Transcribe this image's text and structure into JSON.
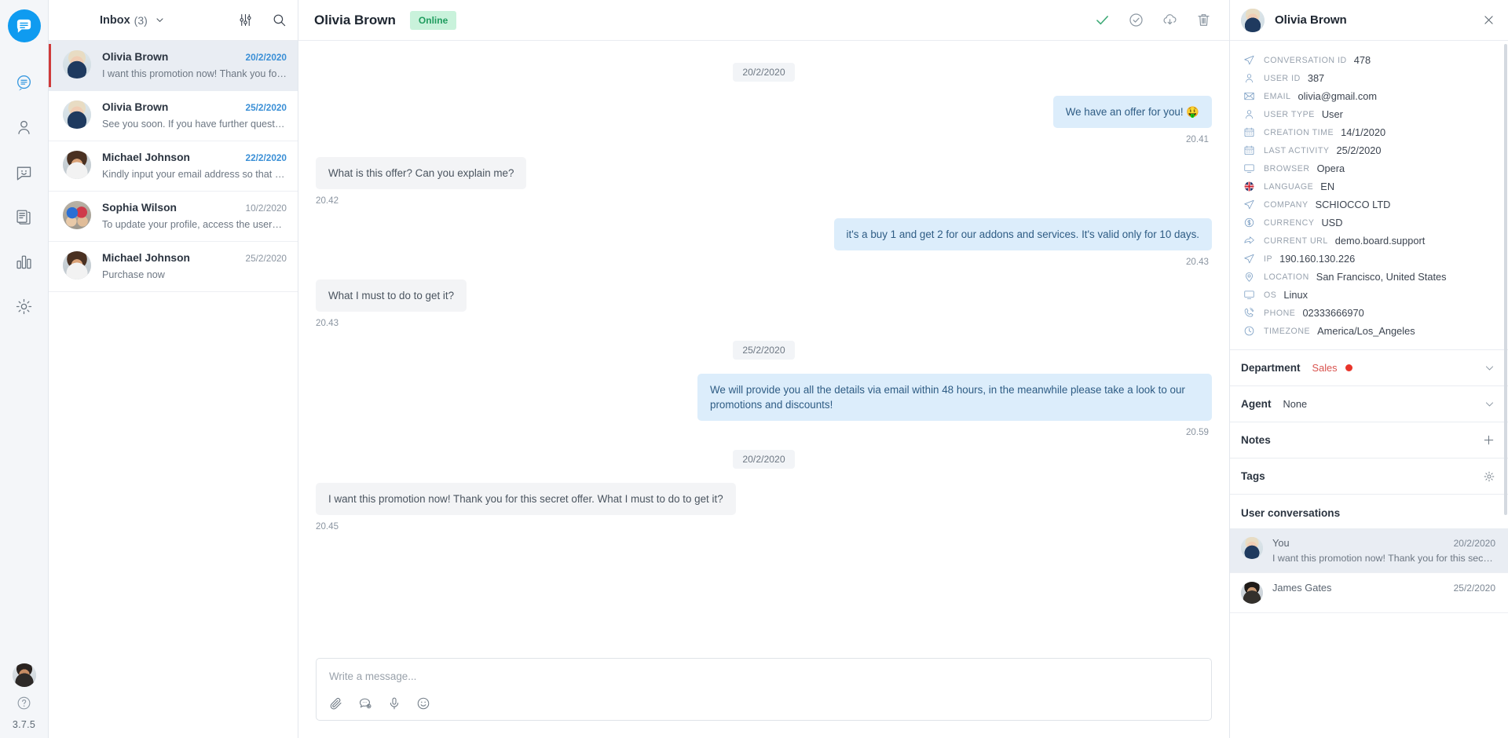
{
  "rail": {
    "logo_icon": "chat-logo-icon",
    "nav": [
      {
        "name": "conversations",
        "icon": "chat-bubble-icon",
        "active": true
      },
      {
        "name": "users",
        "icon": "user-icon",
        "active": false
      },
      {
        "name": "chatbot",
        "icon": "smiley-chat-icon",
        "active": false
      },
      {
        "name": "articles",
        "icon": "documents-icon",
        "active": false
      },
      {
        "name": "reports",
        "icon": "bar-chart-icon",
        "active": false
      },
      {
        "name": "settings",
        "icon": "gear-icon",
        "active": false
      }
    ],
    "help_icon": "help-circle-icon",
    "version": "3.7.5"
  },
  "list": {
    "title": "Inbox",
    "count": "(3)",
    "caret_icon": "chevron-down-icon",
    "filter_icon": "filter-sliders-icon",
    "search_icon": "search-icon",
    "conversations": [
      {
        "name": "Olivia Brown",
        "date": "20/2/2020",
        "preview": "I want this promotion now! Thank you for th…",
        "avatar": "olivia",
        "active": true,
        "unread": true
      },
      {
        "name": "Olivia Brown",
        "date": "25/2/2020",
        "preview": "See you soon. If you have further questions…",
        "avatar": "olivia",
        "active": false,
        "unread": true
      },
      {
        "name": "Michael Johnson",
        "date": "22/2/2020",
        "preview": "Kindly input your email address so that we …",
        "avatar": "michael",
        "active": false,
        "unread": true
      },
      {
        "name": "Sophia Wilson",
        "date": "10/2/2020",
        "preview": "To update your profile, access the users are…",
        "avatar": "sophia",
        "active": false,
        "unread": false
      },
      {
        "name": "Michael Johnson",
        "date": "25/2/2020",
        "preview": "Purchase now",
        "avatar": "michael",
        "active": false,
        "unread": false
      }
    ]
  },
  "chat": {
    "title": "Olivia Brown",
    "status": "Online",
    "actions": [
      {
        "name": "resolve-check-icon"
      },
      {
        "name": "pending-clock-check-icon"
      },
      {
        "name": "download-cloud-icon"
      },
      {
        "name": "delete-trash-icon"
      }
    ],
    "messages": [
      {
        "type": "day",
        "text": "20/2/2020"
      },
      {
        "type": "out",
        "text": "We have an offer for you! 🤑",
        "time": "20.41"
      },
      {
        "type": "in",
        "text": "What is this offer? Can you explain me?",
        "time": "20.42"
      },
      {
        "type": "out",
        "text": "it's a buy 1 and get 2 for our addons and services. It's valid only for 10 days.",
        "time": "20.43"
      },
      {
        "type": "in",
        "text": "What I must to do to get it?",
        "time": "20.43"
      },
      {
        "type": "day",
        "text": "25/2/2020"
      },
      {
        "type": "out",
        "wide": true,
        "text": "We will provide you all the details via email within 48 hours, in the meanwhile please take a look to our promotions and discounts!",
        "time": "20.59"
      },
      {
        "type": "day",
        "text": "20/2/2020"
      },
      {
        "type": "in",
        "text": "I want this promotion now! Thank you for this secret offer. What I must to do to get it?",
        "time": "20.45"
      }
    ],
    "composer": {
      "placeholder": "Write a message...",
      "tools": [
        {
          "name": "attachment-clip-icon"
        },
        {
          "name": "canned-response-icon"
        },
        {
          "name": "microphone-icon"
        },
        {
          "name": "emoji-smiley-icon"
        }
      ]
    }
  },
  "info": {
    "name": "Olivia Brown",
    "close_icon": "close-icon",
    "properties": [
      {
        "icon": "send-plane-icon",
        "key": "Conversation ID",
        "value": "478"
      },
      {
        "icon": "user-icon",
        "key": "User ID",
        "value": "387"
      },
      {
        "icon": "envelope-icon",
        "key": "Email",
        "value": "olivia@gmail.com"
      },
      {
        "icon": "user-icon",
        "key": "User Type",
        "value": "User"
      },
      {
        "icon": "calendar-icon",
        "key": "Creation Time",
        "value": "14/1/2020"
      },
      {
        "icon": "calendar-icon",
        "key": "Last Activity",
        "value": "25/2/2020"
      },
      {
        "icon": "monitor-icon",
        "key": "Browser",
        "value": "Opera"
      },
      {
        "icon": "uk-flag-icon",
        "key": "Language",
        "value": "EN"
      },
      {
        "icon": "send-plane-icon",
        "key": "Company",
        "value": "SCHIOCCO LTD"
      },
      {
        "icon": "currency-dollar-icon",
        "key": "Currency",
        "value": "USD"
      },
      {
        "icon": "arrow-share-icon",
        "key": "Current URL",
        "value": "demo.board.support"
      },
      {
        "icon": "send-plane-icon",
        "key": "IP",
        "value": "190.160.130.226"
      },
      {
        "icon": "map-pin-icon",
        "key": "Location",
        "value": "San Francisco, United States"
      },
      {
        "icon": "monitor-icon",
        "key": "OS",
        "value": "Linux"
      },
      {
        "icon": "phone-icon",
        "key": "Phone",
        "value": "02333666970"
      },
      {
        "icon": "clock-icon",
        "key": "Timezone",
        "value": "America/Los_Angeles"
      }
    ],
    "department": {
      "label": "Department",
      "value": "Sales",
      "status_color": "#e8342a",
      "action_icon": "chevron-down-icon"
    },
    "agent": {
      "label": "Agent",
      "value": "None",
      "action_icon": "chevron-down-icon"
    },
    "notes": {
      "label": "Notes",
      "action_icon": "plus-icon"
    },
    "tags": {
      "label": "Tags",
      "action_icon": "gear-icon"
    },
    "user_conversations": {
      "title": "User conversations",
      "items": [
        {
          "name": "You",
          "date": "20/2/2020",
          "preview": "I want this promotion now! Thank you for this secret …",
          "avatar": "olivia",
          "active": true
        },
        {
          "name": "James Gates",
          "date": "25/2/2020",
          "preview": "",
          "avatar": "james",
          "active": false
        }
      ]
    }
  },
  "colors": {
    "brand": "#0f9bf0",
    "out_bubble": "#dcedfb",
    "in_bubble": "#f3f4f6",
    "online": "#1f9c5e",
    "unread_date": "#3a8fd6"
  }
}
